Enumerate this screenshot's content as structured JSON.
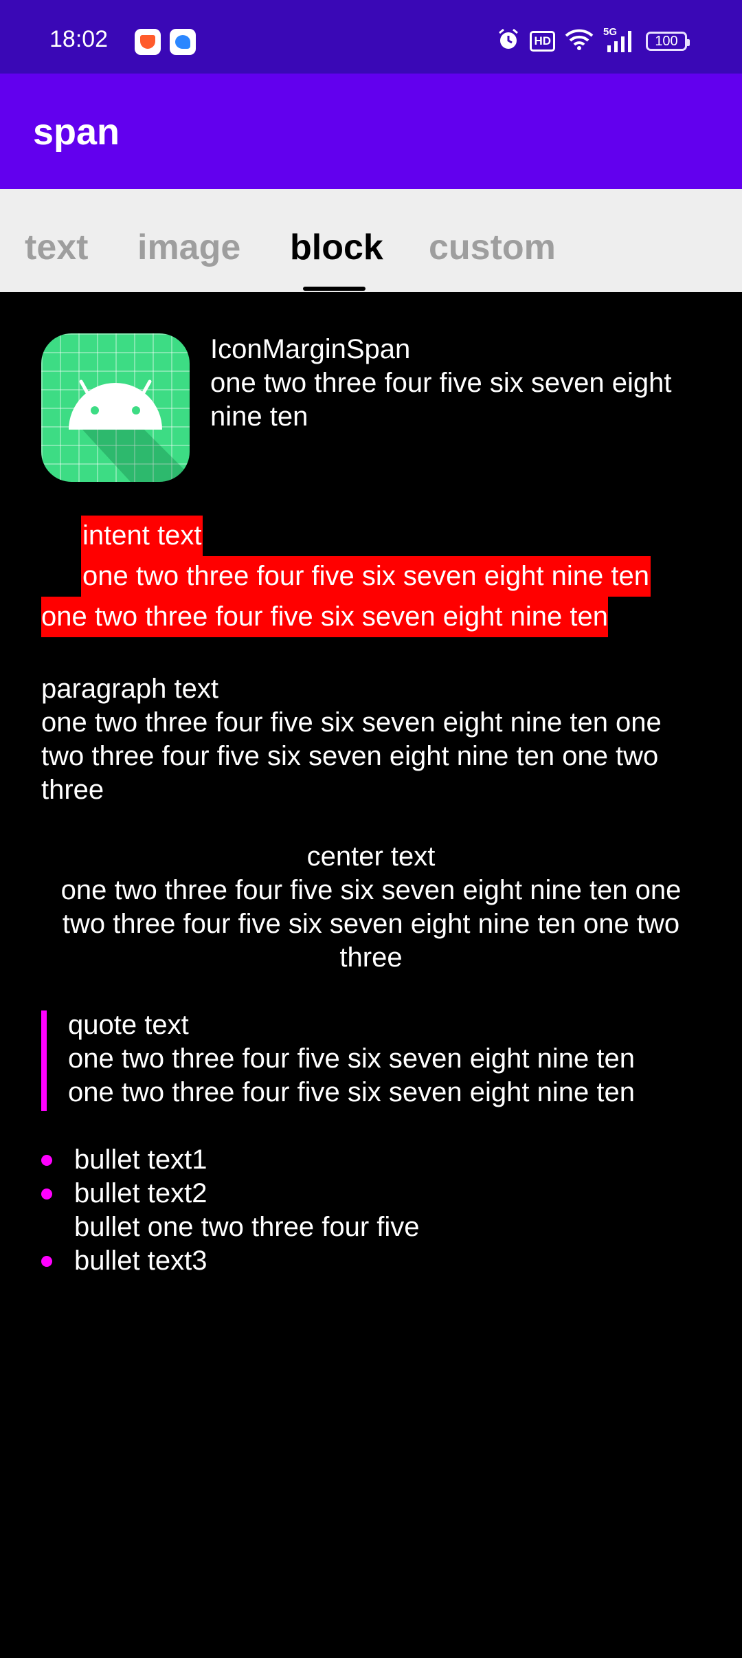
{
  "status_bar": {
    "time": "18:02",
    "hd_label": "HD",
    "network_label": "5G",
    "battery": "100",
    "icons": [
      "app-notification-icon",
      "app-notification-icon",
      "alarm-icon",
      "hd-icon",
      "wifi-icon",
      "signal-5g-icon",
      "battery-icon"
    ]
  },
  "app_bar": {
    "title": "span",
    "color": "#6200ee"
  },
  "tabs": [
    {
      "label": "text",
      "active": false
    },
    {
      "label": "image",
      "active": false
    },
    {
      "label": "block",
      "active": true
    },
    {
      "label": "custom",
      "active": false
    }
  ],
  "content": {
    "icon_margin": {
      "icon": "android-launcher-icon",
      "title": "IconMarginSpan",
      "body": "one two three four five six seven eight nine ten"
    },
    "indent": {
      "line1": "intent text",
      "line2": "one two three four five six seven eight nine ten",
      "line3": "one two three four five six seven eight nine ten",
      "highlight_color": "#ff0000"
    },
    "paragraph": {
      "title": "paragraph text",
      "body": "one two three four five six seven eight nine ten one two three four five six seven eight nine ten one two three"
    },
    "center": {
      "title": "center text",
      "body": "one two three four five six seven eight nine ten one two three four five six seven eight nine ten one two three"
    },
    "quote": {
      "title": "quote text",
      "line1": "one two three four five six seven eight nine ten",
      "line2": "one two three four five six seven eight nine ten",
      "bar_color": "#ff00ff"
    },
    "bullets": [
      {
        "text": "bullet text1",
        "dot": true
      },
      {
        "text": "bullet text2",
        "dot": true
      },
      {
        "text": "bullet one two three four five",
        "dot": false
      },
      {
        "text": "bullet text3",
        "dot": true
      }
    ]
  }
}
